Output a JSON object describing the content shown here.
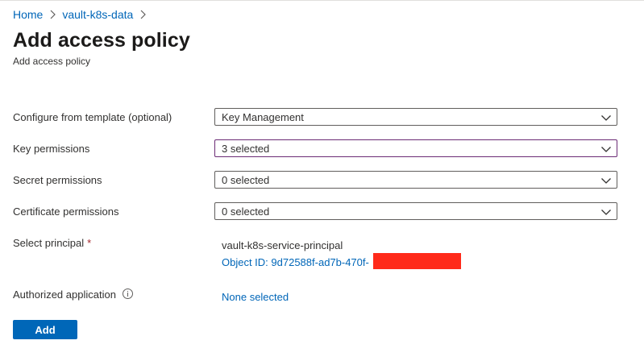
{
  "breadcrumb": {
    "items": [
      {
        "label": "Home"
      },
      {
        "label": "vault-k8s-data"
      }
    ]
  },
  "header": {
    "title": "Add access policy",
    "subtitle": "Add access policy"
  },
  "form": {
    "template": {
      "label": "Configure from template (optional)",
      "value": "Key Management"
    },
    "key_permissions": {
      "label": "Key permissions",
      "value": "3 selected"
    },
    "secret_permissions": {
      "label": "Secret permissions",
      "value": "0 selected"
    },
    "certificate_permissions": {
      "label": "Certificate permissions",
      "value": "0 selected"
    },
    "principal": {
      "label": "Select principal",
      "required_marker": "*",
      "name": "vault-k8s-service-principal",
      "object_id": "Object ID: 9d72588f-ad7b-470f-"
    },
    "authorized_application": {
      "label": "Authorized application",
      "value": "None selected"
    },
    "add_label": "Add"
  },
  "icons": {
    "breadcrumb_separator": "chevron-right-icon",
    "dropdown": "chevron-down-icon",
    "info": "info-icon"
  },
  "colors": {
    "link": "#0066b8",
    "primary_button": "#0067b8",
    "focused_border": "#6b2b75",
    "required": "#a4262c",
    "redaction": "#ff2a1a"
  }
}
